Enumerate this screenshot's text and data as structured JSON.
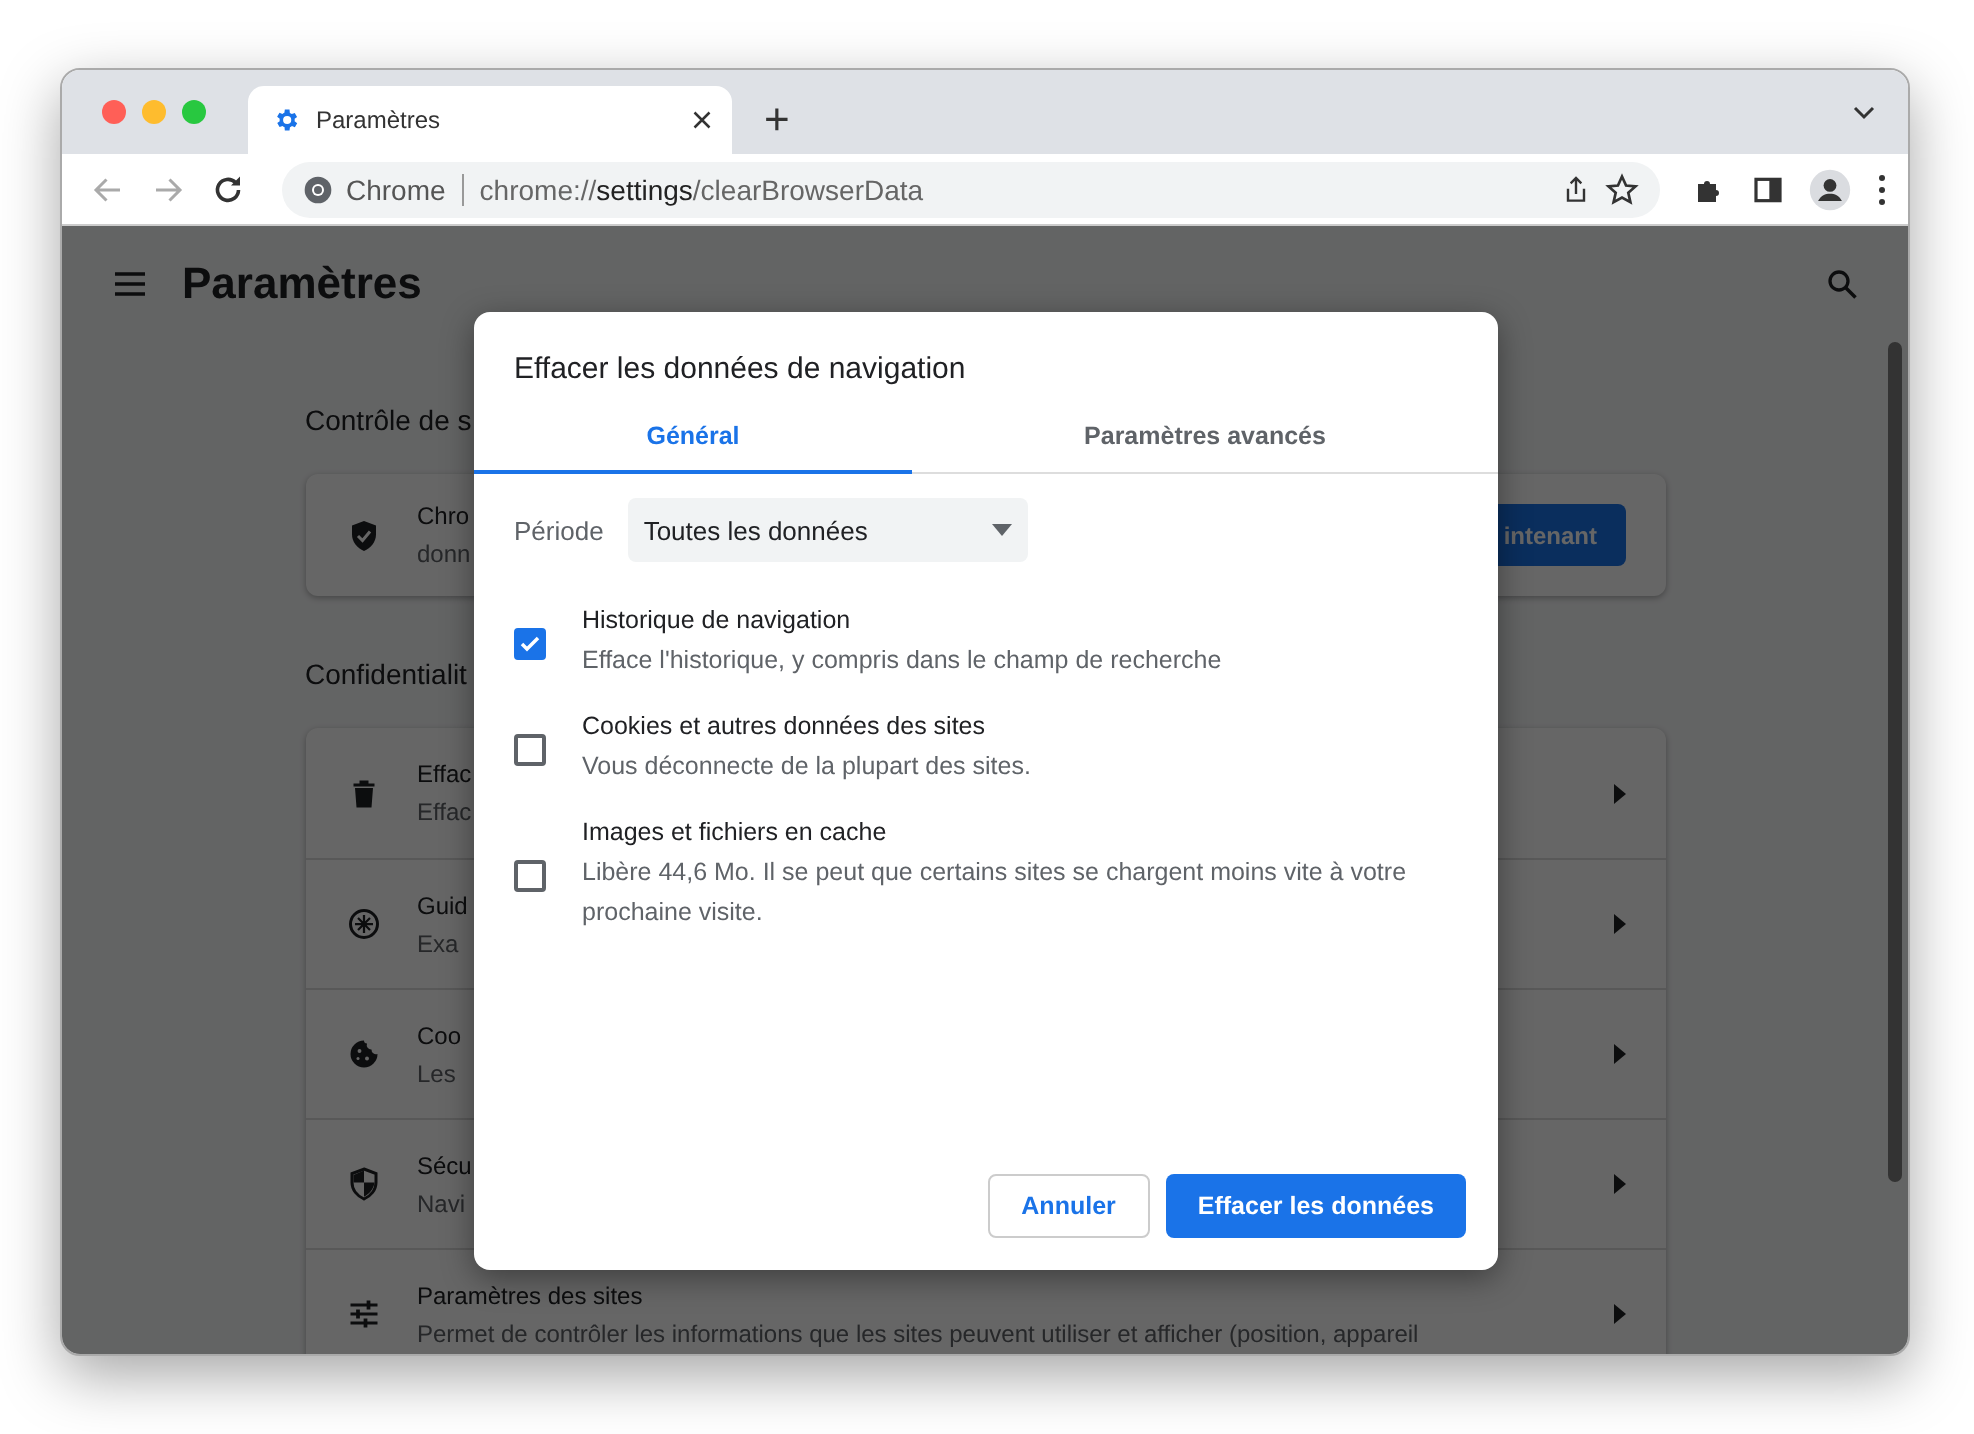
{
  "browser": {
    "tab_title": "Paramètres",
    "new_tab": "+",
    "omnibox_label": "Chrome",
    "url": {
      "scheme": "chrome://",
      "host": "settings",
      "path": "/clearBrowserData"
    }
  },
  "settings": {
    "title": "Paramètres",
    "sections": [
      {
        "heading": "Contrôle de s",
        "items": [
          {
            "kind": "action",
            "title": "Chro",
            "subtitle": "donn",
            "button": "intenant"
          }
        ]
      },
      {
        "heading": "Confidentialit",
        "items": [
          {
            "kind": "link",
            "title": "Effac",
            "subtitle": "Effac"
          },
          {
            "kind": "link",
            "title": "Guid",
            "subtitle": "Exa"
          },
          {
            "kind": "link",
            "title": "Coo",
            "subtitle": "Les"
          },
          {
            "kind": "link",
            "title": "Sécu",
            "subtitle": "Navi"
          },
          {
            "kind": "link",
            "title": "Paramètres des sites",
            "subtitle": "Permet de contrôler les informations que les sites peuvent utiliser et afficher (position, appareil"
          }
        ]
      }
    ]
  },
  "dialog": {
    "title": "Effacer les données de navigation",
    "tabs": [
      {
        "label": "Général",
        "selected": true
      },
      {
        "label": "Paramètres avancés",
        "selected": false
      }
    ],
    "period": {
      "label": "Période",
      "value": "Toutes les données"
    },
    "options": [
      {
        "title": "Historique de navigation",
        "description": "Efface l'historique, y compris dans le champ de recherche",
        "checked": true
      },
      {
        "title": "Cookies et autres données des sites",
        "description": "Vous déconnecte de la plupart des sites.",
        "checked": false
      },
      {
        "title": "Images et fichiers en cache",
        "description": "Libère 44,6 Mo. Il se peut que certains sites se chargent moins vite à votre prochaine visite.",
        "checked": false
      }
    ],
    "buttons": [
      {
        "label": "Annuler",
        "kind": "secondary"
      },
      {
        "label": "Effacer les données",
        "kind": "primary"
      }
    ]
  }
}
